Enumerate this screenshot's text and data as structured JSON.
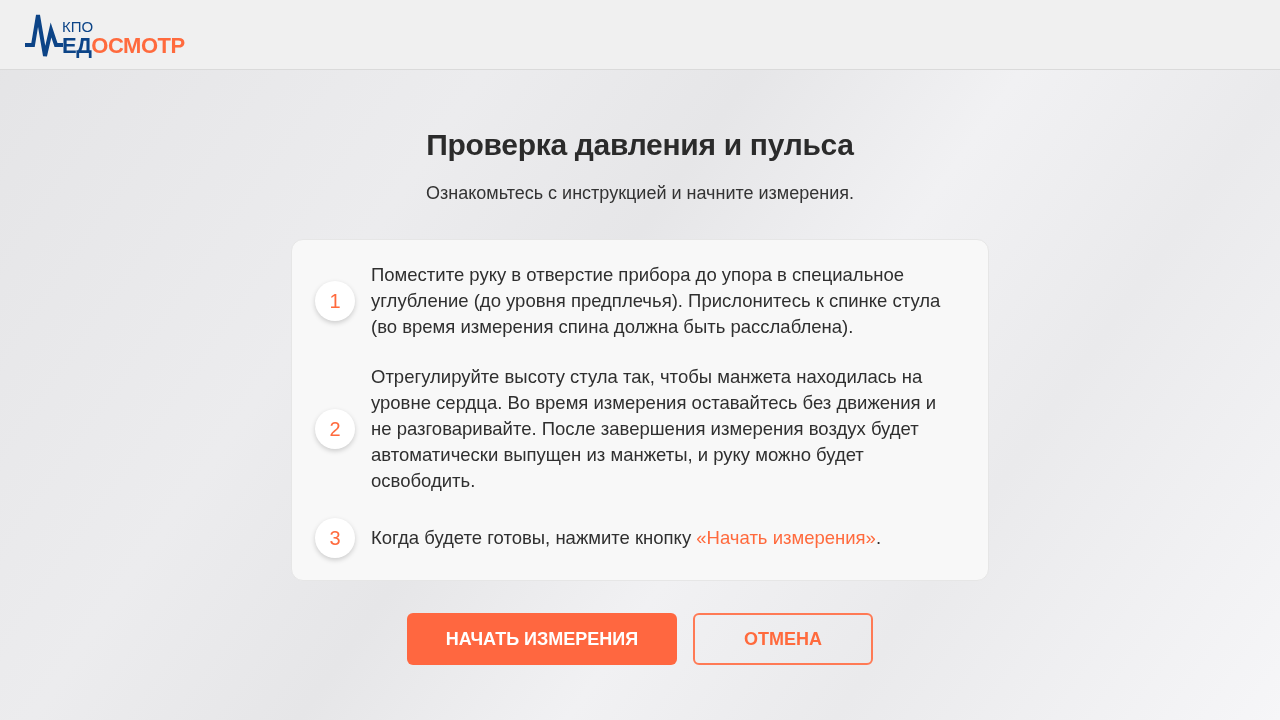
{
  "header": {
    "logo": {
      "caption": "КПО",
      "name_parts": [
        {
          "text": "ЕД",
          "color": "#0c4487"
        },
        {
          "text": "ОСМОТР",
          "color": "#ff6a3d"
        }
      ]
    }
  },
  "title": "Проверка давления и пульса",
  "subtitle": "Ознакомьтесь с инструкцией и начните измерения.",
  "steps": [
    {
      "number": "1",
      "segments": [
        {
          "kind": "plain",
          "text": "Поместите руку в отверстие прибора до упора в специальное углубление (до уровня предплечья). Прислонитесь к спинке стула (во время измерения спина должна быть расслаблена)."
        }
      ]
    },
    {
      "number": "2",
      "segments": [
        {
          "kind": "plain",
          "text": "Отрегулируйте высоту стула так, чтобы манжета находилась на уровне сердца. Во время измерения оставайтесь без движения и не разговаривайте. После завершения измерения воздух будет автоматически выпущен из манжеты, и руку можно будет освободить."
        }
      ]
    },
    {
      "number": "3",
      "segments": [
        {
          "kind": "plain",
          "text": "Когда будете готовы, нажмите кнопку "
        },
        {
          "kind": "highlight",
          "text": "«Начать измерения»"
        },
        {
          "kind": "plain",
          "text": "."
        }
      ]
    }
  ],
  "buttons": [
    {
      "kind": "primary",
      "label": "НАЧАТЬ ИЗМЕРЕНИЯ"
    },
    {
      "kind": "outline",
      "label": "ОТМЕНА"
    }
  ]
}
